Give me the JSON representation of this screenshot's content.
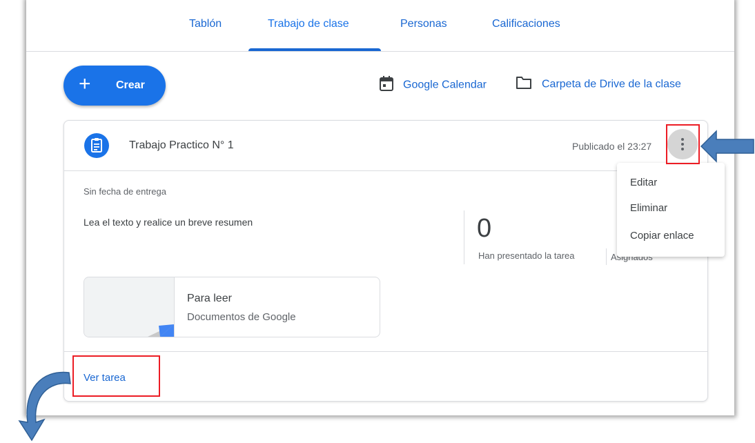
{
  "nav": {
    "tabs": [
      {
        "label": "Tablón"
      },
      {
        "label": "Trabajo de clase"
      },
      {
        "label": "Personas"
      },
      {
        "label": "Calificaciones"
      }
    ],
    "active_tab": "Trabajo de clase"
  },
  "toolbar": {
    "create_label": "Crear",
    "calendar_label": "Google Calendar",
    "drive_label": "Carpeta de Drive de la clase"
  },
  "assignment": {
    "title": "Trabajo Practico N° 1",
    "published": "Publicado el 23:27",
    "due": "Sin fecha de entrega",
    "instructions": "Lea el texto y realice un breve resumen",
    "turned_in_count": "0",
    "turned_in_label": "Han presentado la tarea",
    "assigned_label": "Asignados",
    "attachment": {
      "title": "Para leer",
      "type": "Documentos de Google"
    },
    "view_label": "Ver tarea"
  },
  "menu": {
    "items": [
      {
        "label": "Editar"
      },
      {
        "label": "Eliminar"
      },
      {
        "label": "Copiar enlace"
      }
    ]
  },
  "colors": {
    "accent": "#1a73e8",
    "annotation_red": "#ec1c24",
    "annotation_arrow": "#4a7ebb"
  },
  "icons": [
    "plus-icon",
    "calendar-icon",
    "folder-icon",
    "assignment-icon",
    "more-vert-icon"
  ]
}
